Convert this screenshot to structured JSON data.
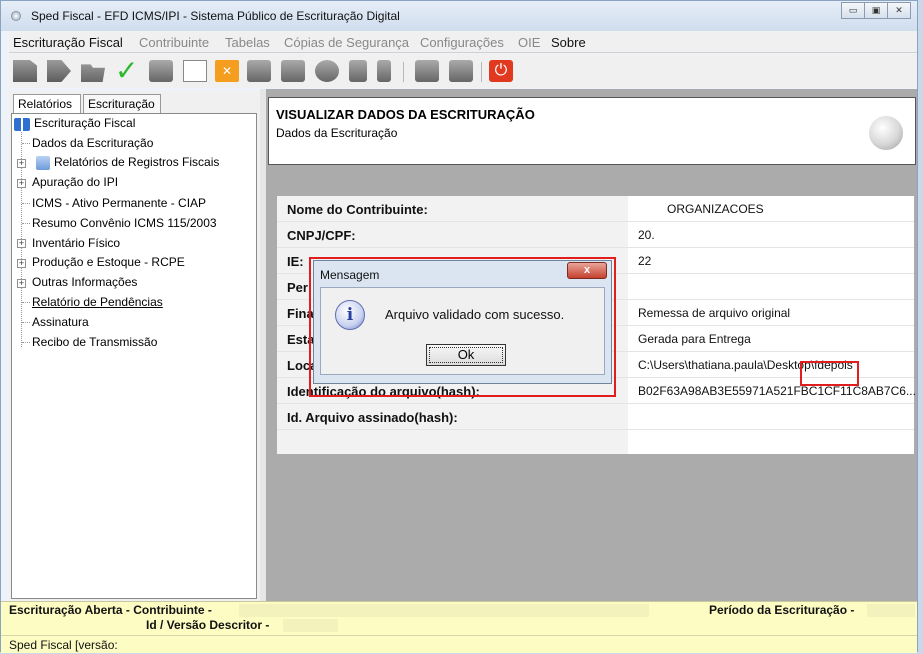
{
  "window": {
    "title": "Sped Fiscal - EFD ICMS/IPI - Sistema Público de Escrituração Digital",
    "controls": [
      "▭",
      "▣",
      "✕"
    ]
  },
  "menu": [
    "Escrituração Fiscal",
    "Contribuinte",
    "Tabelas",
    "Cópias de Segurança",
    "Configurações",
    "OIE",
    "Sobre"
  ],
  "toolbar": {
    "check_glyph": "✓",
    "x_glyph": "✕",
    "power_glyph": "⏻"
  },
  "left": {
    "tabs": [
      "Relatórios",
      "Escrituração"
    ],
    "tree": {
      "root": "Escrituração Fiscal",
      "items": [
        "Dados da Escrituração",
        "Relatórios de Registros Fiscais",
        "Apuração do IPI",
        "ICMS - Ativo Permanente - CIAP",
        "Resumo Convênio ICMS 115/2003",
        "Inventário Físico",
        "Produção e Estoque - RCPE",
        "Outras Informações",
        "Relatório de Pendências",
        "Assinatura",
        "Recibo de Transmissão"
      ]
    }
  },
  "main": {
    "header_title": "VISUALIZAR DADOS DA ESCRITURAÇÃO",
    "header_subtitle": "Dados da Escrituração",
    "rows": [
      {
        "label": "Nome do Contribuinte:",
        "value": "ORGANIZACOES"
      },
      {
        "label": "CNPJ/CPF:",
        "value": "20."
      },
      {
        "label": "IE:",
        "value": "22"
      },
      {
        "label": "Per",
        "value": ""
      },
      {
        "label": "Fina",
        "value": "Remessa de arquivo original"
      },
      {
        "label": "Esta",
        "value": "Gerada para Entrega"
      },
      {
        "label": "Loca",
        "value": "C:\\Users\\thatiana.paula\\Desktop\\fdepois"
      },
      {
        "label": "Identificação do arquivo(hash):",
        "value": "B02F63A98AB3E55971A521FBC1CF11C8AB7C6..."
      },
      {
        "label": "Id. Arquivo assinado(hash):",
        "value": ""
      }
    ]
  },
  "dialog": {
    "title": "Mensagem",
    "close": "x",
    "icon_glyph": "i",
    "message": "Arquivo validado com sucesso.",
    "ok": "Ok"
  },
  "status": {
    "line1": "Escrituração Aberta - Contribuinte -",
    "line1b": "Id / Versão Descritor -",
    "period": "Período da Escrituração -",
    "line2": "Sped Fiscal [versão:"
  }
}
